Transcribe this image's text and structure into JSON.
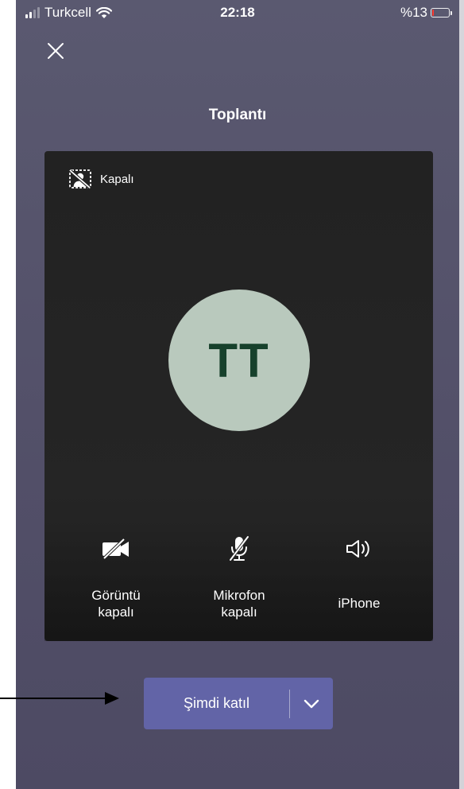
{
  "status_bar": {
    "carrier": "Turkcell",
    "time": "22:18",
    "battery": "%13",
    "battery_level": 0.13
  },
  "header": {
    "title": "Toplantı"
  },
  "preview": {
    "camera_status": "Kapalı",
    "avatar_initials": "TT"
  },
  "controls": {
    "video": {
      "line1": "Görüntü",
      "line2": "kapalı"
    },
    "mic": {
      "line1": "Mikrofon",
      "line2": "kapalı"
    },
    "audio": {
      "label": "iPhone"
    }
  },
  "join": {
    "label": "Şimdi katıl"
  },
  "colors": {
    "background": "#524f68",
    "preview": "#232323",
    "avatar": "#b9c9bd",
    "avatar_text": "#17412c",
    "join_button": "#6264a7"
  }
}
